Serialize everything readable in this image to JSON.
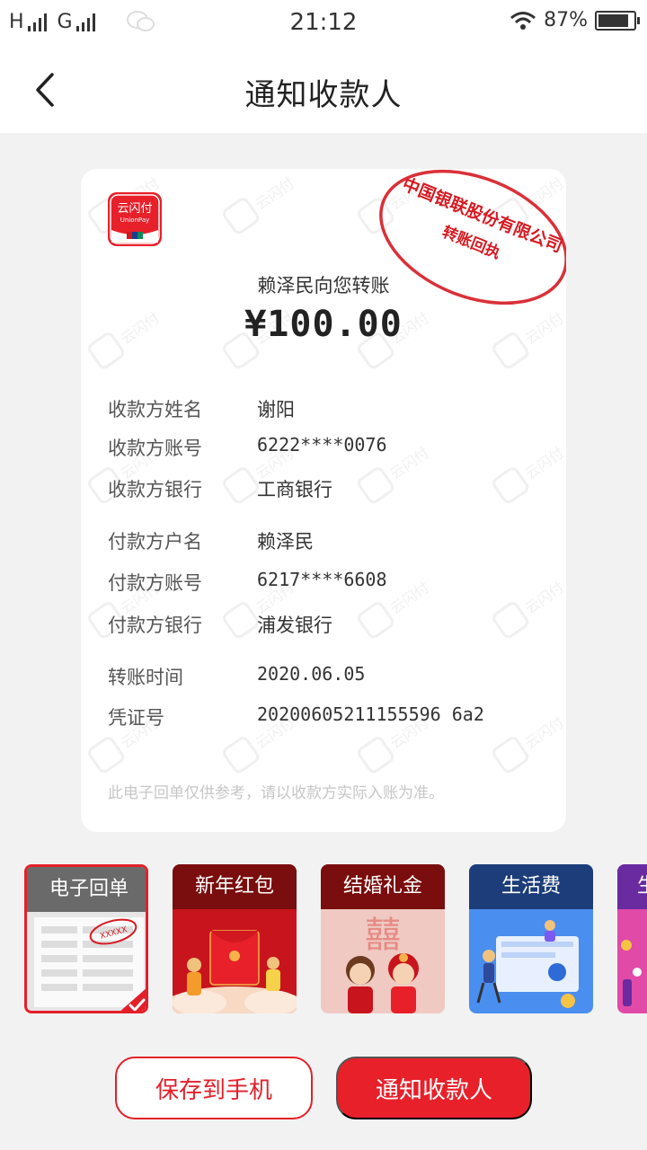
{
  "status_bar": {
    "carrier_1": "H",
    "carrier_2": "G",
    "time": "21:12",
    "battery": "87%",
    "battery_level": 0.87
  },
  "header": {
    "title": "通知收款人",
    "back_icon": "chevron-left-icon"
  },
  "receipt": {
    "logo_text": "云闪付",
    "logo_subtext": "UnionPay",
    "seal_company": "中国银联股份有限公司",
    "seal_subtitle": "转账回执",
    "sender_line": "赖泽民向您转账",
    "amount": "¥100.00",
    "fields": [
      {
        "label": "收款方姓名",
        "value": "谢阳"
      },
      {
        "label": "收款方账号",
        "value": "6222****0076"
      },
      {
        "label": "收款方银行",
        "value": "工商银行"
      },
      {
        "label": "付款方户名",
        "value": "赖泽民"
      },
      {
        "label": "付款方账号",
        "value": "6217****6608"
      },
      {
        "label": "付款方银行",
        "value": "浦发银行"
      },
      {
        "label": "转账时间",
        "value": "2020.06.05"
      },
      {
        "label": "凭证号",
        "value": "20200605211155596 6a2"
      }
    ],
    "disclaimer": "此电子回单仅供参考，请以收款方实际入账为准。",
    "watermark_text": "云闪付"
  },
  "templates": [
    {
      "label": "电子回单",
      "selected": true,
      "mini_stamp": "XXXXX"
    },
    {
      "label": "新年红包",
      "selected": false
    },
    {
      "label": "结婚礼金",
      "selected": false
    },
    {
      "label": "生活费",
      "selected": false
    },
    {
      "label": "生",
      "selected": false
    }
  ],
  "actions": {
    "save_label": "保存到手机",
    "notify_label": "通知收款人"
  },
  "colors": {
    "accent": "#e8202a",
    "background": "#f2f2f2",
    "card": "#ffffff"
  }
}
